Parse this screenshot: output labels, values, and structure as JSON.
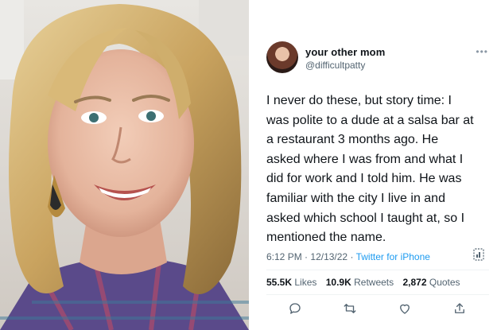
{
  "tweet": {
    "author": {
      "display_name": "your other mom",
      "handle": "@difficultpatty"
    },
    "more_icon": "more-icon",
    "text_lines": [
      "I never do these, but story time: I",
      "was polite to a dude at a salsa bar at",
      "a restaurant 3 months ago. He",
      "asked where I was from and what I",
      "did for work and I told him. He was",
      "familiar with the city I live in and",
      "asked which school I taught at, so I",
      "mentioned the name."
    ],
    "meta": {
      "time": "6:12 PM",
      "date": "12/13/22",
      "separator": "·",
      "source": "Twitter for iPhone"
    },
    "stats": {
      "likes_count": "55.5K",
      "likes_label": "Likes",
      "retweets_count": "10.9K",
      "retweets_label": "Retweets",
      "quotes_count": "2,872",
      "quotes_label": "Quotes"
    },
    "actions": [
      "reply-icon",
      "retweet-icon",
      "like-icon",
      "share-icon"
    ]
  },
  "colors": {
    "accent": "#1d9bf0",
    "secondary_text": "#536471",
    "primary_text": "#0f1419"
  }
}
